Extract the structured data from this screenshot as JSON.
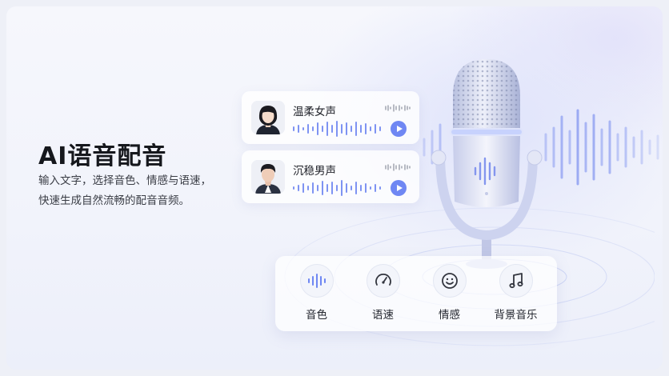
{
  "hero": {
    "title": "AI语音配音",
    "desc_line1": "输入文字，选择音色、情感与语速，",
    "desc_line2": "快速生成自然流畅的配音音频。"
  },
  "voices": [
    {
      "name": "温柔女声",
      "avatar_icon": "female-avatar"
    },
    {
      "name": "沉稳男声",
      "avatar_icon": "male-avatar"
    }
  ],
  "tools": [
    {
      "label": "音色",
      "icon": "waveform-icon"
    },
    {
      "label": "语速",
      "icon": "speedometer-icon"
    },
    {
      "label": "情感",
      "icon": "smiley-icon"
    },
    {
      "label": "背景音乐",
      "icon": "music-note-icon"
    }
  ],
  "colors": {
    "accent": "#6f87f3",
    "title": "#16181d",
    "wave": "#7e93f2"
  }
}
